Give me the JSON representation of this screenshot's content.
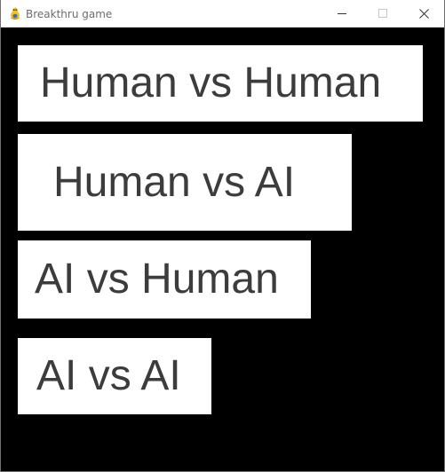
{
  "window": {
    "title": "Breakthru game",
    "app_icon": "pygame-snake-icon",
    "controls": {
      "minimize_icon": "minimize-icon",
      "maximize_icon": "maximize-icon",
      "close_icon": "close-icon"
    }
  },
  "menu": {
    "items": [
      {
        "label": "Human vs Human"
      },
      {
        "label": "Human vs AI"
      },
      {
        "label": "AI vs Human"
      },
      {
        "label": "AI vs AI"
      }
    ]
  },
  "colors": {
    "background": "#000000",
    "button_background": "#ffffff",
    "button_text": "#3c3c3c",
    "titlebar": "#ffffff"
  }
}
